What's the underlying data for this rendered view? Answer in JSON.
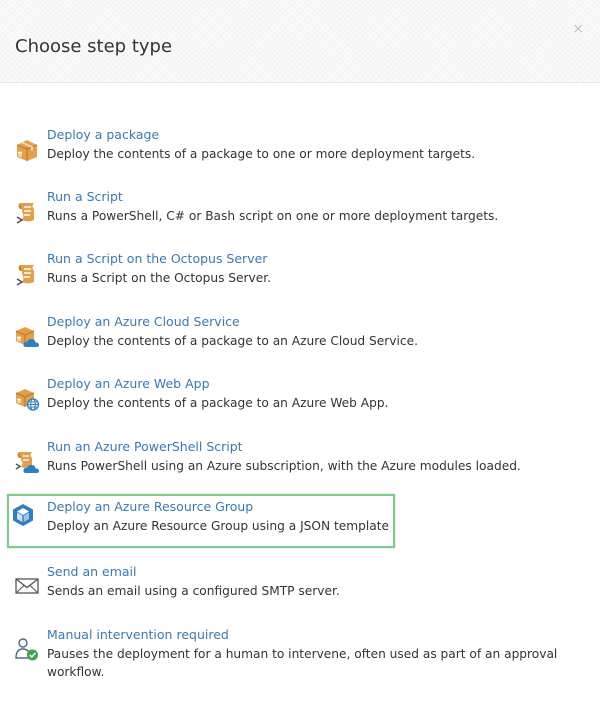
{
  "dialog": {
    "title": "Choose step type",
    "close_label": "×"
  },
  "steps": [
    {
      "name": "Deploy a package",
      "description": "Deploy the contents of a package to one or more deployment targets.",
      "icon": "package-icon"
    },
    {
      "name": "Run a Script",
      "description": "Runs a PowerShell, C# or Bash script on one or more deployment targets.",
      "icon": "script-icon"
    },
    {
      "name": "Run a Script on the Octopus Server",
      "description": "Runs a Script on the Octopus Server.",
      "icon": "script-server-icon"
    },
    {
      "name": "Deploy an Azure Cloud Service",
      "description": "Deploy the contents of a package to an Azure Cloud Service.",
      "icon": "azure-cloud-service-icon"
    },
    {
      "name": "Deploy an Azure Web App",
      "description": "Deploy the contents of a package to an Azure Web App.",
      "icon": "azure-web-app-icon"
    },
    {
      "name": "Run an Azure PowerShell Script",
      "description": "Runs PowerShell using an Azure subscription, with the Azure modules loaded.",
      "icon": "azure-powershell-icon"
    },
    {
      "name": "Deploy an Azure Resource Group",
      "description": "Deploy an Azure Resource Group using a JSON template",
      "icon": "azure-resource-group-icon",
      "selected": true
    },
    {
      "name": "Send an email",
      "description": "Sends an email using a configured SMTP server.",
      "icon": "email-icon"
    },
    {
      "name": "Manual intervention required",
      "description": "Pauses the deployment for a human to intervene, often used as part of an approval workflow.",
      "icon": "manual-intervention-icon"
    }
  ],
  "colors": {
    "link": "#3a78b5",
    "package_orange": "#d9953a",
    "azure_blue": "#2e7fc2",
    "selection_green": "#7ecb8c",
    "check_green": "#3aa64d"
  }
}
